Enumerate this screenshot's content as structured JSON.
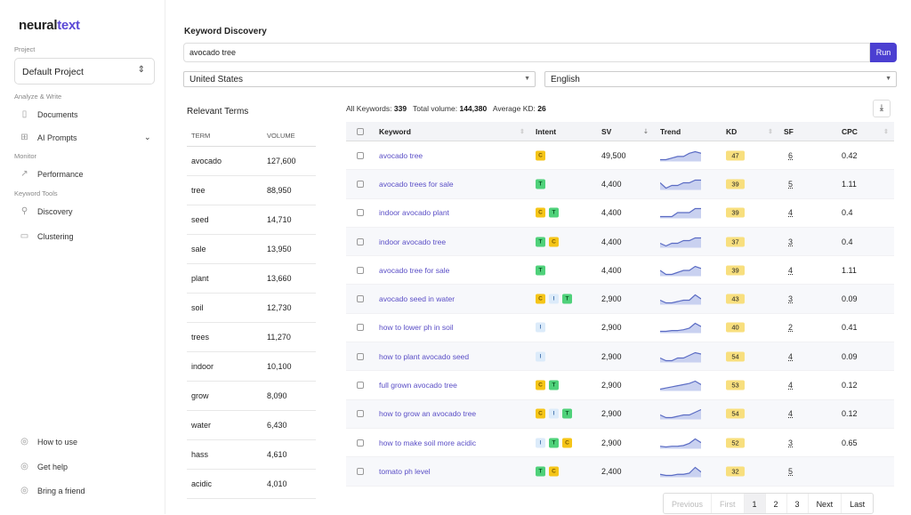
{
  "brand": {
    "part1": "neural",
    "part2": "text"
  },
  "sidebar": {
    "project_label": "Project",
    "project_value": "Default Project",
    "sections": {
      "analyze": "Analyze & Write",
      "monitor": "Monitor",
      "keyword_tools": "Keyword Tools"
    },
    "items": [
      {
        "label": "Documents",
        "icon": "document-icon"
      },
      {
        "label": "AI Prompts",
        "icon": "grid-icon"
      },
      {
        "label": "Performance",
        "icon": "trend-icon"
      },
      {
        "label": "Discovery",
        "icon": "key-icon"
      },
      {
        "label": "Clustering",
        "icon": "cluster-icon"
      }
    ],
    "footer": [
      {
        "label": "How to use",
        "icon": "play-icon"
      },
      {
        "label": "Get help",
        "icon": "help-icon"
      },
      {
        "label": "Bring a friend",
        "icon": "gift-icon"
      }
    ]
  },
  "main": {
    "title": "Keyword Discovery",
    "search_value": "avocado tree",
    "run_label": "Run",
    "country": "United States",
    "language": "English"
  },
  "relevant_terms": {
    "title": "Relevant Terms",
    "headers": [
      "TERM",
      "VOLUME"
    ],
    "rows": [
      [
        "avocado",
        "127,600"
      ],
      [
        "tree",
        "88,950"
      ],
      [
        "seed",
        "14,710"
      ],
      [
        "sale",
        "13,950"
      ],
      [
        "plant",
        "13,660"
      ],
      [
        "soil",
        "12,730"
      ],
      [
        "trees",
        "11,270"
      ],
      [
        "indoor",
        "10,100"
      ],
      [
        "grow",
        "8,090"
      ],
      [
        "water",
        "6,430"
      ],
      [
        "hass",
        "4,610"
      ],
      [
        "acidic",
        "4,010"
      ]
    ]
  },
  "stats": {
    "all_label": "All Keywords:",
    "all": "339",
    "vol_label": "Total volume:",
    "vol": "144,380",
    "kd_label": "Average KD:",
    "kd": "26"
  },
  "table": {
    "headers": [
      "Keyword",
      "Intent",
      "SV",
      "Trend",
      "KD",
      "SF",
      "CPC"
    ],
    "rows": [
      {
        "kw": "avocado tree",
        "intent": [
          "C"
        ],
        "sv": "49,500",
        "kd": "47",
        "sf": "6",
        "cpc": "0.42",
        "trend": [
          5,
          5,
          5.5,
          6,
          6,
          7,
          7.5,
          7
        ]
      },
      {
        "kw": "avocado trees for sale",
        "intent": [
          "T"
        ],
        "sv": "4,400",
        "kd": "39",
        "sf": "5",
        "cpc": "1.11",
        "trend": [
          6,
          4,
          5,
          5,
          6,
          6,
          7,
          7
        ]
      },
      {
        "kw": "indoor avocado plant",
        "intent": [
          "C",
          "T"
        ],
        "sv": "4,400",
        "kd": "39",
        "sf": "4",
        "cpc": "0.4",
        "trend": [
          6,
          6,
          6,
          6.5,
          6.5,
          6.5,
          7,
          7
        ]
      },
      {
        "kw": "indoor avocado tree",
        "intent": [
          "T",
          "C"
        ],
        "sv": "4,400",
        "kd": "37",
        "sf": "3",
        "cpc": "0.4",
        "trend": [
          6,
          5.5,
          6,
          6,
          6.5,
          6.5,
          7,
          7
        ]
      },
      {
        "kw": "avocado tree for sale",
        "intent": [
          "T"
        ],
        "sv": "4,400",
        "kd": "39",
        "sf": "4",
        "cpc": "1.11",
        "trend": [
          6,
          5,
          5,
          5.5,
          6,
          6,
          7,
          6.5
        ]
      },
      {
        "kw": "avocado seed in water",
        "intent": [
          "C",
          "I",
          "T"
        ],
        "sv": "2,900",
        "kd": "43",
        "sf": "3",
        "cpc": "0.09",
        "trend": [
          5,
          4,
          4,
          4.5,
          5,
          5,
          7,
          5.5
        ]
      },
      {
        "kw": "how to lower ph in soil",
        "intent": [
          "I"
        ],
        "sv": "2,900",
        "kd": "40",
        "sf": "2",
        "cpc": "0.41",
        "trend": [
          3,
          3,
          3.5,
          3.5,
          4,
          5,
          8,
          6
        ]
      },
      {
        "kw": "how to plant avocado seed",
        "intent": [
          "I"
        ],
        "sv": "2,900",
        "kd": "54",
        "sf": "4",
        "cpc": "0.09",
        "trend": [
          5,
          4,
          4,
          5,
          5,
          6,
          7,
          6.5
        ]
      },
      {
        "kw": "full grown avocado tree",
        "intent": [
          "C",
          "T"
        ],
        "sv": "2,900",
        "kd": "53",
        "sf": "4",
        "cpc": "0.12",
        "trend": [
          4,
          4.5,
          5,
          5.5,
          6,
          6.5,
          7.5,
          6
        ]
      },
      {
        "kw": "how to grow an avocado tree",
        "intent": [
          "C",
          "I",
          "T"
        ],
        "sv": "2,900",
        "kd": "54",
        "sf": "4",
        "cpc": "0.12",
        "trend": [
          5,
          4,
          4,
          4.5,
          5,
          5,
          6,
          7
        ]
      },
      {
        "kw": "how to make soil more acidic",
        "intent": [
          "I",
          "T",
          "C"
        ],
        "sv": "2,900",
        "kd": "52",
        "sf": "3",
        "cpc": "0.65",
        "trend": [
          3,
          2.5,
          3,
          3,
          3.5,
          5,
          8,
          5.5
        ]
      },
      {
        "kw": "tomato ph level",
        "intent": [
          "T",
          "C"
        ],
        "sv": "2,400",
        "kd": "32",
        "sf": "5",
        "cpc": "",
        "trend": [
          5,
          4.5,
          4.5,
          5,
          5,
          5.5,
          8,
          6
        ]
      }
    ]
  },
  "pagination": {
    "previous": "Previous",
    "first": "First",
    "pages": [
      "1",
      "2",
      "3"
    ],
    "current": "1",
    "next": "Next",
    "last": "Last"
  },
  "colors": {
    "accent": "#4b3fd1",
    "link": "#5a4ec6",
    "kd": "#f8df7e",
    "trend_line": "#5b6cc4",
    "trend_fill": "#c9d1f0"
  }
}
